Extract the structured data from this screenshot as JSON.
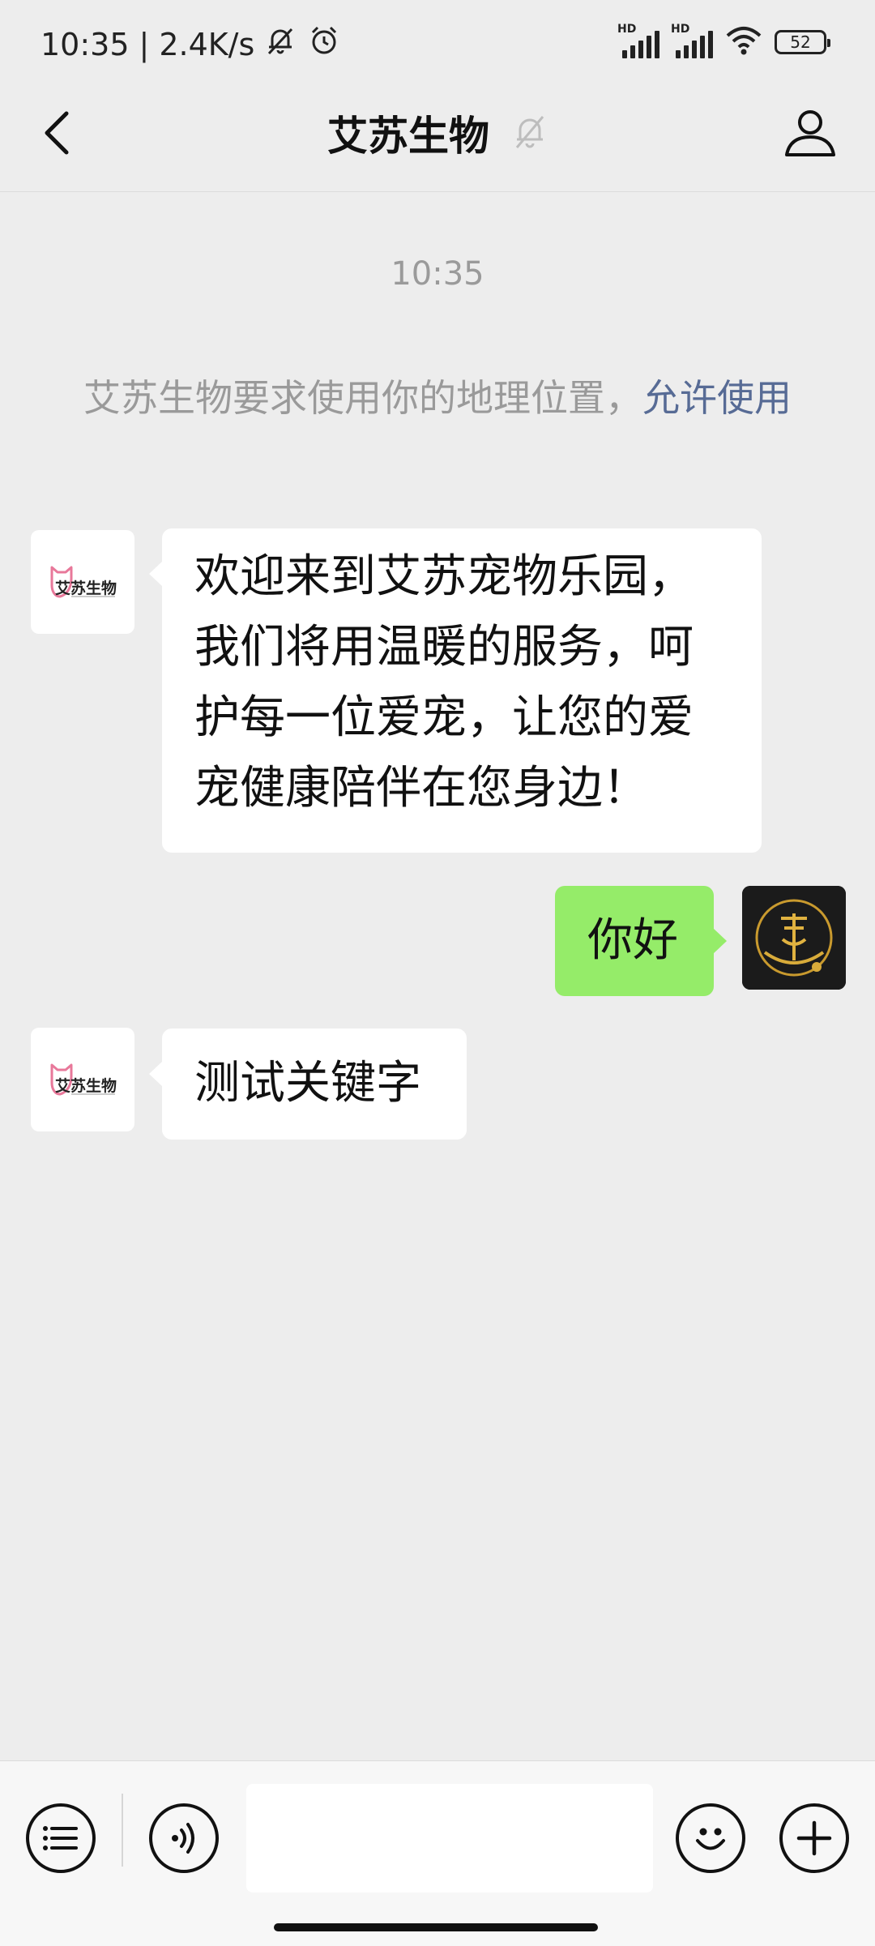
{
  "status_bar": {
    "time": "10:35",
    "network_speed": "2.4K/s",
    "signal_1_label": "HD",
    "signal_2_label": "HD",
    "battery_level": "52",
    "icons": [
      "mute-notification-icon",
      "alarm-icon",
      "signal-icon",
      "signal-icon",
      "wifi-icon",
      "battery-icon"
    ]
  },
  "nav": {
    "title": "艾苏生物",
    "icons": [
      "back-arrow-icon",
      "mute-bell-icon",
      "profile-icon"
    ]
  },
  "chat": {
    "timestamp": "10:35",
    "system_message": {
      "text": "艾苏生物要求使用你的地理位置，",
      "link": "允许使用"
    },
    "messages": [
      {
        "sender": "艾苏生物",
        "side": "left",
        "avatar_text": "艾苏生物",
        "text": "欢迎来到艾苏宠物乐园，我们将用温暖的服务，呵护每一位爱宠，让您的爱宠健康陪伴在您身边！"
      },
      {
        "sender": "me",
        "side": "right",
        "text": "你好"
      },
      {
        "sender": "艾苏生物",
        "side": "left",
        "avatar_text": "艾苏生物",
        "text": "测试关键字"
      }
    ]
  },
  "input_bar": {
    "message_input_value": "",
    "icons": [
      "menu-list-icon",
      "voice-icon",
      "emoji-icon",
      "add-icon"
    ]
  },
  "colors": {
    "background": "#ededed",
    "link": "#576b95",
    "sent_bubble": "#95ec69",
    "received_bubble": "#ffffff",
    "logo_pink": "#e8789a"
  }
}
